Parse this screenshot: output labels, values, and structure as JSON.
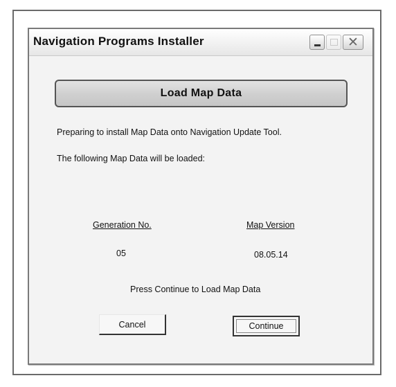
{
  "window": {
    "title": "Navigation Programs Installer",
    "controls": {
      "minimize_icon": "minimize-icon",
      "maximize_icon": "maximize-icon",
      "close_icon": "close-icon"
    }
  },
  "banner": {
    "label": "Load Map Data"
  },
  "messages": {
    "intro": "Preparing to install Map Data onto Navigation Update Tool.",
    "following": "The following Map Data will be loaded:"
  },
  "table": {
    "generation_header": "Generation No.",
    "version_header": "Map Version",
    "generation_value": "05",
    "version_value": "08.05.14"
  },
  "prompt": "Press Continue to Load Map Data",
  "buttons": {
    "cancel": "Cancel",
    "continue": "Continue"
  },
  "colors": {
    "window_bg": "#f3f3f3",
    "banner_bg": "#cfcfcf",
    "border": "#555555"
  }
}
